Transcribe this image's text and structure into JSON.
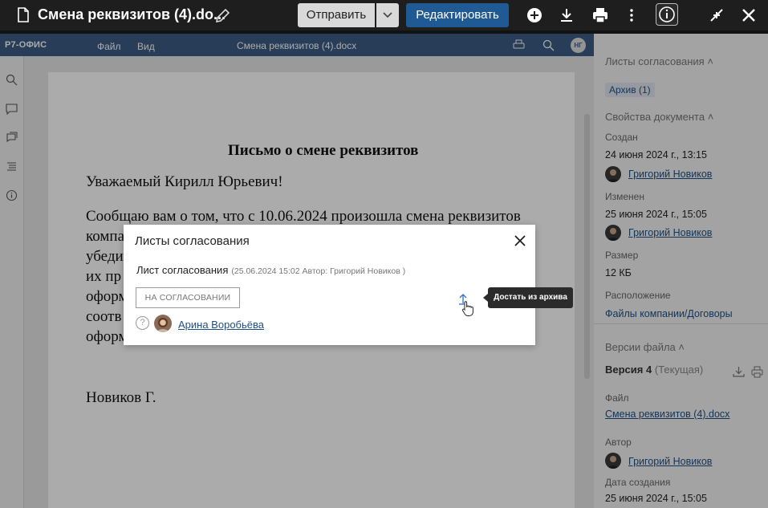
{
  "header": {
    "title": "Смена реквизитов (4).do...",
    "send_label": "Отправить",
    "edit_label": "Редактировать"
  },
  "editor": {
    "brand": "Р7-ОФИС",
    "menu": [
      "Файл",
      "Вид"
    ],
    "doc_name": "Смена реквизитов (4).docx",
    "user_initials": "НГ"
  },
  "document": {
    "heading": "Письмо о смене реквизитов",
    "greeting": "Уважаемый Кирилл Юрьевич!",
    "paragraph_lines": [
      "Сообщаю вам о том, что с 10.06.2024 произошла смена реквизитов",
      "компа",
      "убеди",
      "их пр",
      "оформ",
      "соотв",
      "оформ"
    ],
    "signature": "Новиков Г."
  },
  "right_panel": {
    "approval_sheets_header": "Листы согласования",
    "archive_tag": "Архив (1)",
    "properties_header": "Свойства документа",
    "created_label": "Создан",
    "created_value": "24 июня 2024 г., 13:15",
    "created_by": "Григорий Новиков",
    "modified_label": "Изменен",
    "modified_value": "25 июня 2024 г., 15:05",
    "modified_by": "Григорий Новиков",
    "size_label": "Размер",
    "size_value": "12 КБ",
    "location_label": "Расположение",
    "location_value": "Файлы компании/Договоры",
    "versions_header": "Версии файла",
    "version_label": "Версия 4",
    "version_current": "(Текущая)",
    "file_label": "Файл",
    "file_value": "Смена реквизитов (4).docx",
    "author_label": "Автор",
    "author_value": "Григорий Новиков",
    "creation_date_label": "Дата создания",
    "creation_date_value": "25 июня 2024 г., 15:05"
  },
  "modal": {
    "title": "Листы согласования",
    "sheet_label": "Лист согласования",
    "sheet_meta": "(25.06.2024 15:02 Автор: Григорий Новиков )",
    "status": "НА СОГЛАСОВАНИИ",
    "approver": "Арина Воробьёва",
    "tooltip": "Достать из архива"
  },
  "colors": {
    "accent": "#1f5a94",
    "editor_bar": "#3b5b84",
    "link": "#1d4f86"
  }
}
